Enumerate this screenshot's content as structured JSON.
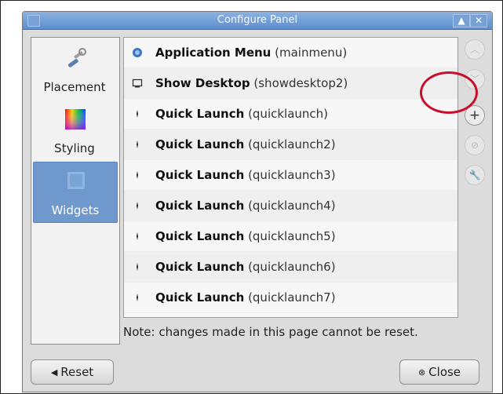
{
  "window": {
    "title": "Configure Panel",
    "title_buttons": [
      "▲",
      "✕"
    ]
  },
  "sidebar": {
    "items": [
      {
        "label": "Placement",
        "icon": "wrench-screwdriver-icon",
        "active": false
      },
      {
        "label": "Styling",
        "icon": "color-palette-icon",
        "active": false
      },
      {
        "label": "Widgets",
        "icon": "widgets-icon",
        "active": true
      }
    ]
  },
  "widgets": {
    "rows": [
      {
        "name": "Application Menu",
        "id": "(mainmenu)",
        "icon": "app-menu-icon"
      },
      {
        "name": "Show Desktop",
        "id": "(showdesktop2)",
        "icon": "show-desktop-icon"
      },
      {
        "name": "Quick Launch",
        "id": "(quicklaunch)",
        "icon": "quicklaunch-icon"
      },
      {
        "name": "Quick Launch",
        "id": "(quicklaunch2)",
        "icon": "quicklaunch-icon"
      },
      {
        "name": "Quick Launch",
        "id": "(quicklaunch3)",
        "icon": "quicklaunch-icon"
      },
      {
        "name": "Quick Launch",
        "id": "(quicklaunch4)",
        "icon": "quicklaunch-icon"
      },
      {
        "name": "Quick Launch",
        "id": "(quicklaunch5)",
        "icon": "quicklaunch-icon"
      },
      {
        "name": "Quick Launch",
        "id": "(quicklaunch6)",
        "icon": "quicklaunch-icon"
      },
      {
        "name": "Quick Launch",
        "id": "(quicklaunch7)",
        "icon": "quicklaunch-icon"
      }
    ]
  },
  "side_buttons": {
    "up": "︿",
    "down": "﹀",
    "add": "+",
    "remove": "⊘",
    "configure": "🔧"
  },
  "note": "Note: changes made in this page cannot be reset.",
  "footer": {
    "reset_label": "Reset",
    "close_label": "Close"
  }
}
